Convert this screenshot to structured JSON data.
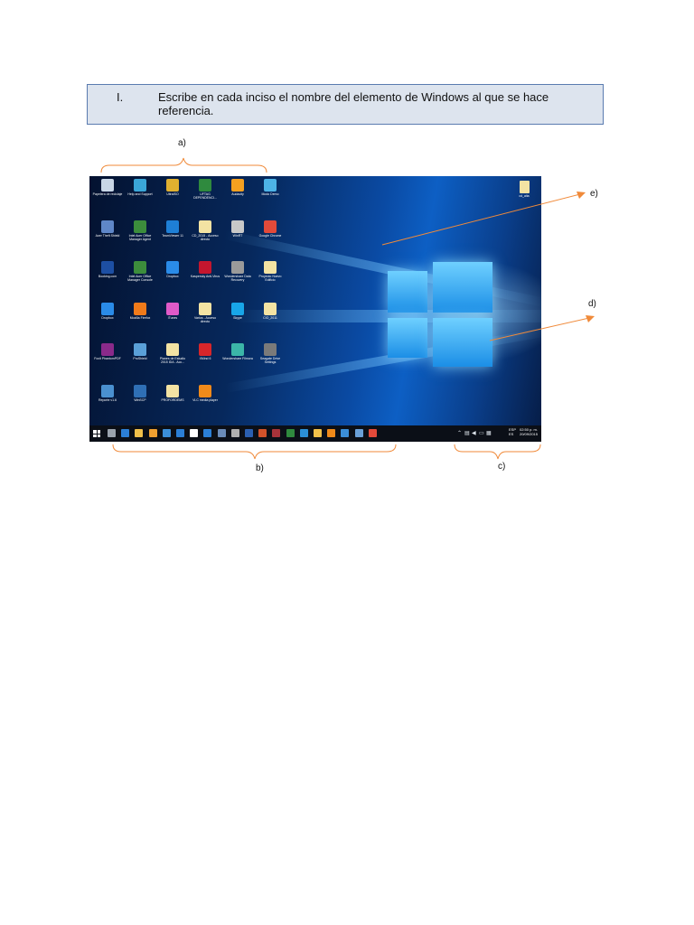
{
  "instruction": {
    "number": "I.",
    "text": "Escribe en cada inciso el nombre del elemento de Windows al que se hace referencia."
  },
  "labels": {
    "a": "a)",
    "b": "b)",
    "c": "c)",
    "d": "d)",
    "e": "e)"
  },
  "colors": {
    "annotation": "#f08a3a",
    "box_border": "#5a7bb0",
    "box_fill": "#dde4ee"
  },
  "desktop": {
    "icons": [
      {
        "label": "Papelera de reciclaje",
        "color": "#c9d6e6",
        "icon": "recycle-bin-icon"
      },
      {
        "label": "Help and Support",
        "color": "#3aa6d8",
        "icon": "help-icon"
      },
      {
        "label": "UltraISO",
        "color": "#e0b030",
        "icon": "disc-icon"
      },
      {
        "label": "UFTAG DEPENDENCI...",
        "color": "#2f8a3e",
        "icon": "excel-icon"
      },
      {
        "label": "Audacity",
        "color": "#f5a020",
        "icon": "audacity-icon"
      },
      {
        "label": "Modo Demo",
        "color": "#4db3e6",
        "icon": "monitor-icon"
      },
      {
        "label": "Acer Theft Shield",
        "color": "#5f87c8",
        "icon": "shield-icon"
      },
      {
        "label": "Intel Acer Office Manager Agent",
        "color": "#3c8d3c",
        "icon": "office-manager-icon"
      },
      {
        "label": "TeamViewer 11",
        "color": "#1e7fd6",
        "icon": "teamviewer-icon"
      },
      {
        "label": "CD_2015 - Acceso directo",
        "color": "#f3e3a3",
        "icon": "shortcut-icon"
      },
      {
        "label": "WinRT",
        "color": "#c8c8c8",
        "icon": "key-icon"
      },
      {
        "label": "Google Chrome",
        "color": "#e24a3a",
        "icon": "chrome-icon"
      },
      {
        "label": "Booking.com",
        "color": "#1d4fa3",
        "icon": "booking-icon"
      },
      {
        "label": "Intel Acer Office Manager Console",
        "color": "#3c8d3c",
        "icon": "office-console-icon"
      },
      {
        "label": "Dropbox",
        "color": "#2a8be8",
        "icon": "dropbox-icon"
      },
      {
        "label": "Kaspersky Anti-Virus",
        "color": "#c4162e",
        "icon": "kaspersky-icon"
      },
      {
        "label": "Wondershare Data Recovery",
        "color": "#9a9a9a",
        "icon": "recovery-icon"
      },
      {
        "label": "Proyecto Nuevo Edificio",
        "color": "#f3e3a3",
        "icon": "folder-icon"
      },
      {
        "label": "Dropbox",
        "color": "#2a8be8",
        "icon": "dropbox-icon"
      },
      {
        "label": "Mozilla Firefox",
        "color": "#f07a1a",
        "icon": "firefox-icon"
      },
      {
        "label": "iTunes",
        "color": "#e05ac8",
        "icon": "itunes-icon"
      },
      {
        "label": "Varios - Acceso directo",
        "color": "#f3e3a3",
        "icon": "shortcut-icon"
      },
      {
        "label": "Skype",
        "color": "#18a6e8",
        "icon": "skype-icon"
      },
      {
        "label": "CIO_2011",
        "color": "#f3e3a3",
        "icon": "folder-icon"
      },
      {
        "label": "Foxit PhantomPDF",
        "color": "#8a2a8a",
        "icon": "pdf-icon"
      },
      {
        "label": "ProShield",
        "color": "#5aa0d8",
        "icon": "proshield-icon"
      },
      {
        "label": "Planes de Estudio 2015 IDA - Acc...",
        "color": "#f3e3a3",
        "icon": "shortcut-icon"
      },
      {
        "label": "XMind 6",
        "color": "#d8262a",
        "icon": "xmind-icon"
      },
      {
        "label": "Wondershare Filmora",
        "color": "#3bb6a8",
        "icon": "filmora-icon"
      },
      {
        "label": "Seagate Drive Settings",
        "color": "#7a7a7a",
        "icon": "drive-icon"
      },
      {
        "label": "Reporte v1.6",
        "color": "#4a90d0",
        "icon": "report-icon"
      },
      {
        "label": "WinSCP",
        "color": "#2f6fb5",
        "icon": "winscp-icon"
      },
      {
        "label": "PROFORDEMS",
        "color": "#f3e3a3",
        "icon": "shortcut-icon"
      },
      {
        "label": "VLC media player",
        "color": "#f08a1a",
        "icon": "vlc-icon"
      }
    ],
    "file": {
      "label": "cd_alta",
      "icon": "document-icon"
    }
  },
  "taskbar": {
    "apps": [
      {
        "icon": "task-view-icon",
        "color": "#9aa3ad"
      },
      {
        "icon": "edge-icon",
        "color": "#2b7fd6"
      },
      {
        "icon": "explorer-icon",
        "color": "#f2c14a"
      },
      {
        "icon": "store-icon",
        "color": "#f0a030"
      },
      {
        "icon": "mail-icon",
        "color": "#3b8ed8"
      },
      {
        "icon": "people-icon",
        "color": "#2b7fd6"
      },
      {
        "icon": "home-icon",
        "color": "#ffffff"
      },
      {
        "icon": "app-icon",
        "color": "#2b7fd6"
      },
      {
        "icon": "app-icon",
        "color": "#6a8bb8"
      },
      {
        "icon": "app-icon",
        "color": "#b0b0b0"
      },
      {
        "icon": "word-icon",
        "color": "#2b5fb0"
      },
      {
        "icon": "powerpoint-icon",
        "color": "#d2522a"
      },
      {
        "icon": "access-icon",
        "color": "#a8333a"
      },
      {
        "icon": "excel-icon",
        "color": "#2f8a3e"
      },
      {
        "icon": "ie-icon",
        "color": "#2b8fd6"
      },
      {
        "icon": "folder-icon",
        "color": "#f2c14a"
      },
      {
        "icon": "flame-icon",
        "color": "#f08a1a"
      },
      {
        "icon": "app-icon",
        "color": "#3b8ed8"
      },
      {
        "icon": "app-icon",
        "color": "#6aa0d8"
      },
      {
        "icon": "chrome-icon",
        "color": "#e24a3a"
      }
    ],
    "language": "ESP\nES",
    "time": "02:50 p. m.",
    "date": "20/09/2015"
  }
}
